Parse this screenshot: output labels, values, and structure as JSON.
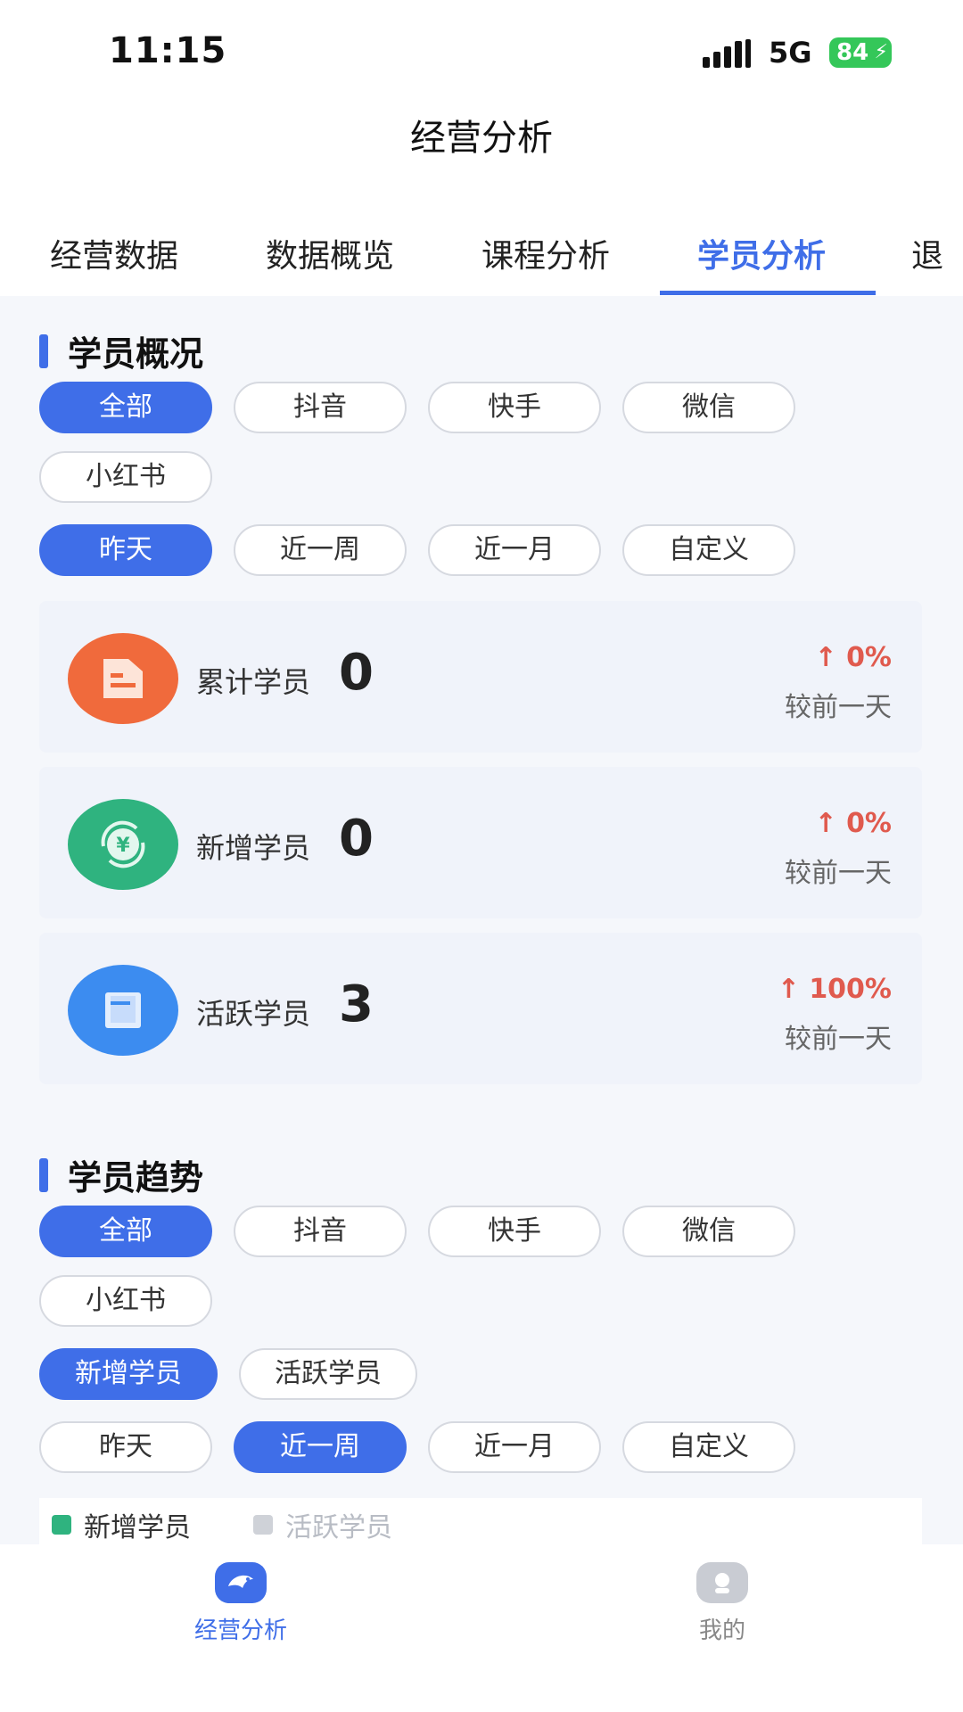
{
  "status_bar": {
    "time": "11:15",
    "network": "5G",
    "battery": "84"
  },
  "nav": {
    "title": "经营分析"
  },
  "tabs": [
    {
      "label": "经营数据"
    },
    {
      "label": "数据概览"
    },
    {
      "label": "课程分析"
    },
    {
      "label": "学员分析",
      "active": true
    },
    {
      "label": "退"
    }
  ],
  "overview": {
    "title": "学员概况",
    "platforms": [
      "全部",
      "抖音",
      "快手",
      "微信",
      "小红书"
    ],
    "active_platform": "全部",
    "periods": [
      "昨天",
      "近一周",
      "近一月",
      "自定义"
    ],
    "active_period": "昨天",
    "cards": [
      {
        "label": "累计学员",
        "value": "0",
        "change": "0%",
        "compare": "较前一天",
        "icon": "document-icon",
        "color": "#f06a3c"
      },
      {
        "label": "新增学员",
        "value": "0",
        "change": "0%",
        "compare": "较前一天",
        "icon": "yuan-cycle-icon",
        "color": "#2fb37f"
      },
      {
        "label": "活跃学员",
        "value": "3",
        "change": "100%",
        "compare": "较前一天",
        "icon": "book-icon",
        "color": "#3c8cf0"
      }
    ]
  },
  "trend": {
    "title": "学员趋势",
    "platforms": [
      "全部",
      "抖音",
      "快手",
      "微信",
      "小红书"
    ],
    "active_platform": "全部",
    "metrics": [
      "新增学员",
      "活跃学员"
    ],
    "active_metric": "新增学员",
    "periods": [
      "昨天",
      "近一周",
      "近一月",
      "自定义"
    ],
    "active_period": "近一周",
    "legend": [
      {
        "label": "新增学员",
        "color": "#2fb37f"
      },
      {
        "label": "活跃学员",
        "color": "#cfd2d8"
      }
    ]
  },
  "bottom_nav": [
    {
      "label": "经营分析",
      "active": true
    },
    {
      "label": "我的"
    }
  ],
  "colors": {
    "accent": "#3f6ee8",
    "up": "#e05a4e"
  }
}
